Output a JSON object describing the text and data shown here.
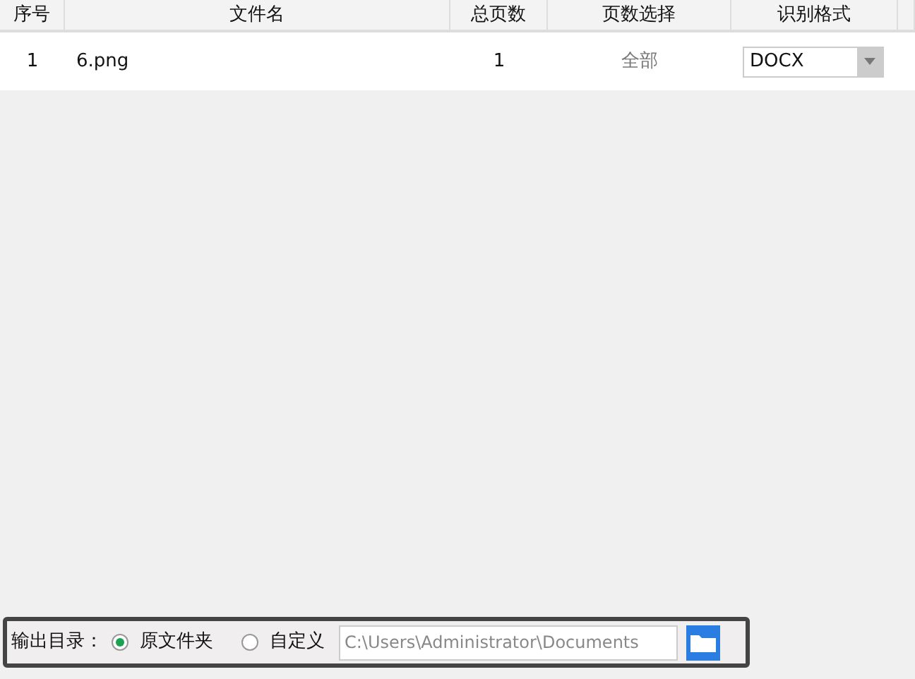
{
  "table": {
    "columns": [
      "序号",
      "文件名",
      "总页数",
      "页数选择",
      "识别格式"
    ],
    "rows": [
      {
        "index": "1",
        "file_name": "6.png",
        "total_pages": "1",
        "page_selection": "全部",
        "format": "DOCX"
      }
    ]
  },
  "output": {
    "label": "输出目录：",
    "options": [
      {
        "label": "原文件夹",
        "selected": true
      },
      {
        "label": "自定义",
        "selected": false
      }
    ],
    "path": "C:\\Users\\Administrator\\Documents"
  }
}
